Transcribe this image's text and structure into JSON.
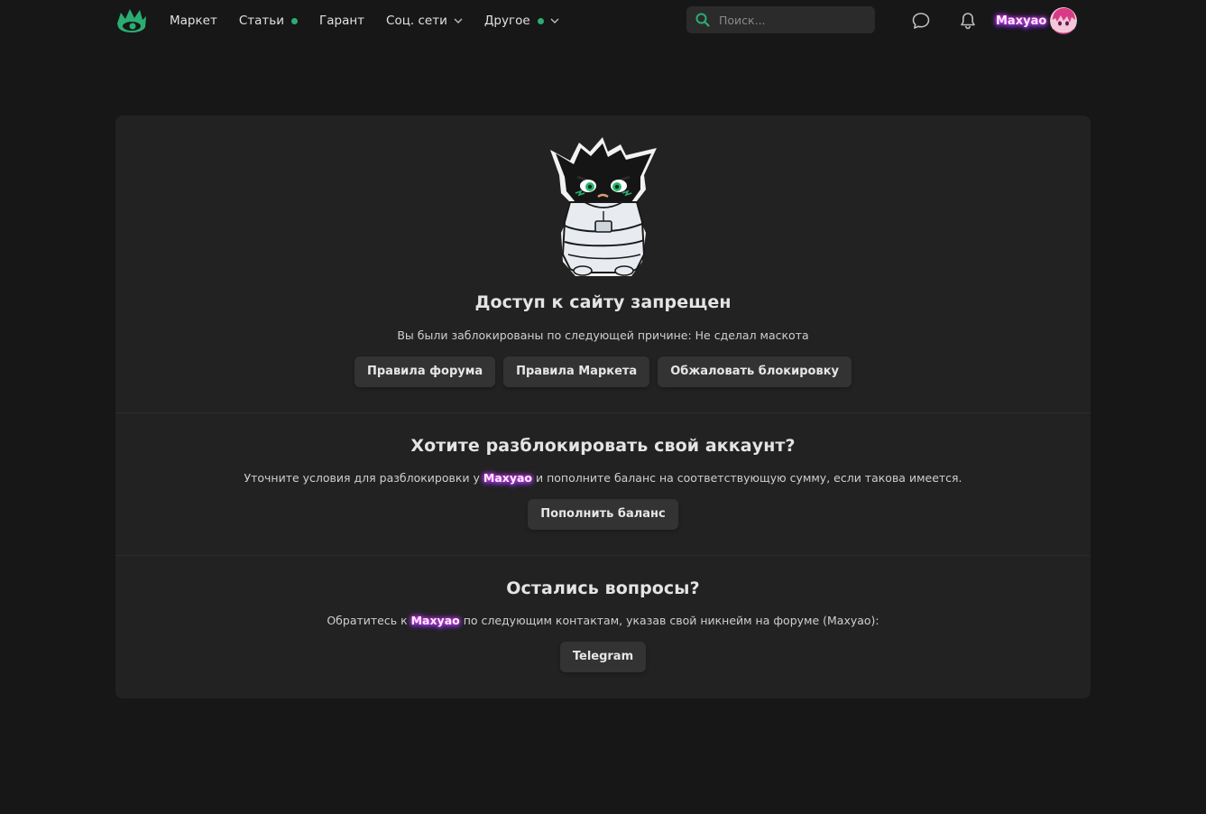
{
  "header": {
    "nav": [
      {
        "label": "Маркет",
        "dot": false,
        "chevron": false
      },
      {
        "label": "Статьи",
        "dot": true,
        "chevron": false
      },
      {
        "label": "Гарант",
        "dot": false,
        "chevron": false
      },
      {
        "label": "Соц. сети",
        "dot": false,
        "chevron": true
      },
      {
        "label": "Другое",
        "dot": true,
        "chevron": true
      }
    ],
    "search_placeholder": "Поиск...",
    "username": "Maxyao",
    "icons": {
      "logo": "eye-crown-logo",
      "search": "search-icon",
      "messages": "chat-bubble-icon",
      "notifications": "bell-icon"
    },
    "accent_color": "#2bad72"
  },
  "banned": {
    "title": "Доступ к сайту запрещен",
    "reason_text": "Вы были заблокированы по следующей причине: Не сделал маскота",
    "buttons": [
      "Правила форума",
      "Правила Маркета",
      "Обжаловать блокировку"
    ]
  },
  "unlock": {
    "title": "Хотите разблокировать свой аккаунт?",
    "text_before": "Уточните условия для разблокировки у ",
    "nick": "Maxyao",
    "text_after": " и пополните баланс на соответствующую сумму, если такова имеется.",
    "button": "Пополнить баланс"
  },
  "questions": {
    "title": "Остались вопросы?",
    "text_before": "Обратитесь к ",
    "nick": "Maxyao",
    "text_after": " по следующим контактам, указав свой никнейм на форуме (Maxyao):",
    "button": "Telegram"
  }
}
